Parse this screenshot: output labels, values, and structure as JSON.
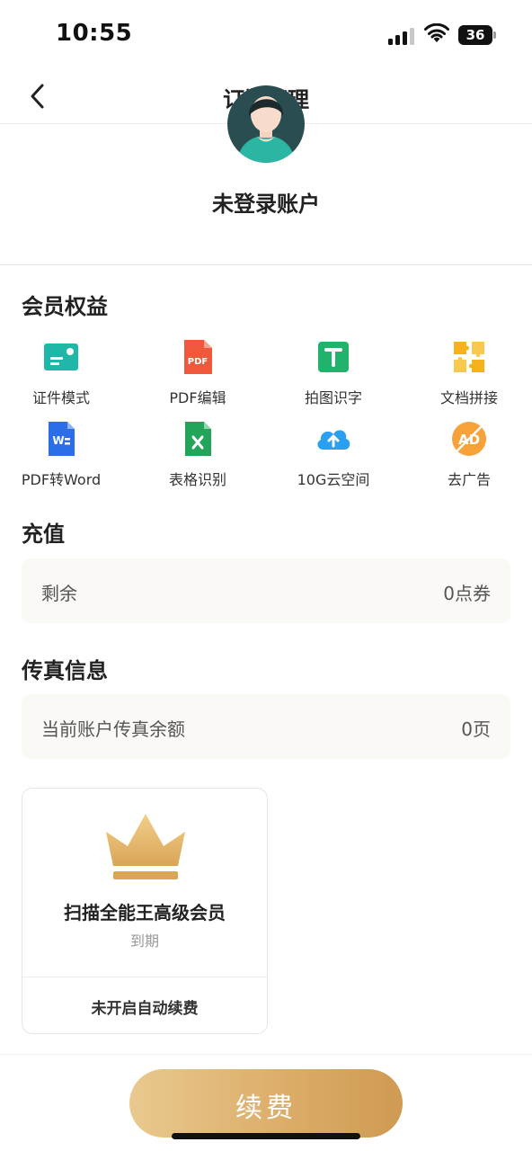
{
  "status_bar": {
    "time": "10:55",
    "battery": "36"
  },
  "nav": {
    "title": "订阅管理",
    "back_icon": "chevron-left-icon"
  },
  "profile": {
    "name": "未登录账户",
    "avatar_icon": "user-avatar-icon"
  },
  "benefits": {
    "title": "会员权益",
    "items": [
      {
        "label": "证件模式",
        "icon": "id-card-icon",
        "color": "#1fb8a8"
      },
      {
        "label": "PDF编辑",
        "icon": "pdf-edit-icon",
        "color": "#f0583b"
      },
      {
        "label": "拍图识字",
        "icon": "ocr-text-icon",
        "color": "#21b36b"
      },
      {
        "label": "文档拼接",
        "icon": "puzzle-icon",
        "color": "#f5b21d"
      },
      {
        "label": "PDF转Word",
        "icon": "word-doc-icon",
        "color": "#2b6ee6"
      },
      {
        "label": "表格识别",
        "icon": "excel-icon",
        "color": "#22a45a"
      },
      {
        "label": "10G云空间",
        "icon": "cloud-upload-icon",
        "color": "#2b9ff0"
      },
      {
        "label": "去广告",
        "icon": "no-ad-icon",
        "color": "#f7a238"
      }
    ]
  },
  "recharge": {
    "title": "充值",
    "label": "剩余",
    "value": "0点券"
  },
  "fax": {
    "title": "传真信息",
    "label": "当前账户传真余额",
    "value": "0页"
  },
  "membership": {
    "title": "扫描全能王高级会员",
    "status": "到期",
    "auto_renew": "未开启自动续费",
    "icon": "crown-icon"
  },
  "renew_button": {
    "label": "续费"
  }
}
